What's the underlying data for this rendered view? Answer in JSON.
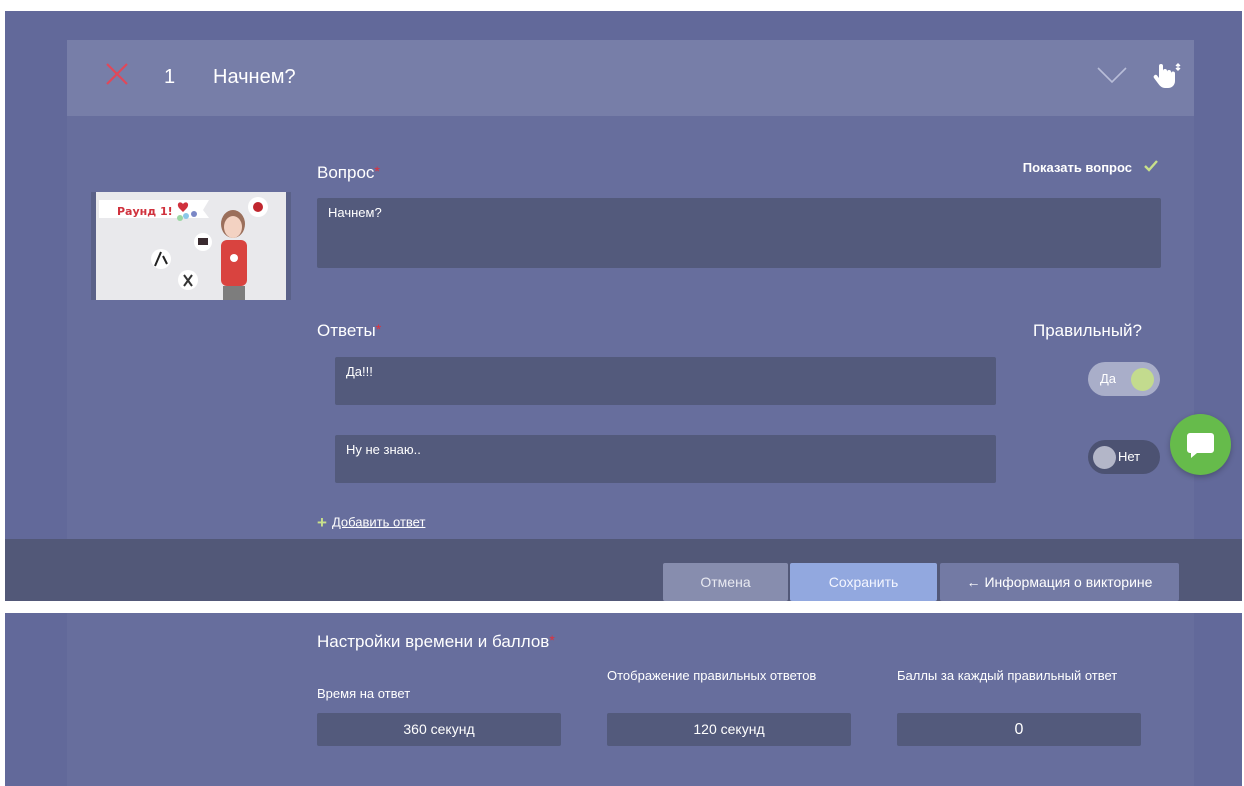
{
  "question_card": {
    "number": "1",
    "title": "Начнем?",
    "question_label": "Вопрос",
    "show_question_label": "Показать вопрос",
    "question_value": "Начнем?",
    "answers_label": "Ответы",
    "correct_label": "Правильный?",
    "thumbnail": {
      "caption": "Раунд 1!"
    },
    "answers": [
      {
        "value": "Да!!!",
        "correct": true,
        "toggle_label": "Да"
      },
      {
        "value": "Ну не знаю..",
        "correct": false,
        "toggle_label": "Нет"
      }
    ],
    "add_answer_label": "Добавить ответ"
  },
  "footer": {
    "cancel_label": "Отмена",
    "save_label": "Сохранить",
    "info_label": "Информация о викторине"
  },
  "settings": {
    "title": "Настройки времени и баллов",
    "fields": [
      {
        "label": "Время на ответ",
        "value": "360 секунд"
      },
      {
        "label": "Отображение правильных ответов",
        "value": "120 секунд"
      },
      {
        "label": "Баллы за каждый правильный ответ",
        "value": "0"
      }
    ]
  },
  "colors": {
    "background": "#62699a",
    "card": "#676e9d",
    "header": "#777ea8",
    "field": "#535a7c",
    "accent_green": "#c8e08a",
    "required": "#e0303b",
    "chat_button": "#66bb4b"
  },
  "icons": [
    "close-icon",
    "chevron-down-icon",
    "drag-hand-icon",
    "checkmark-icon",
    "plus-icon",
    "arrow-left-icon",
    "chat-icon"
  ]
}
